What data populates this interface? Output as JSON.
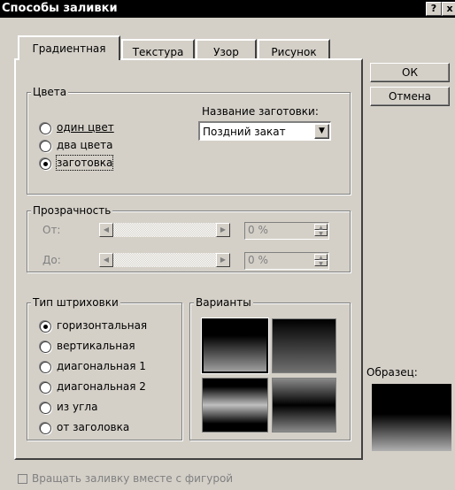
{
  "window": {
    "title": "Способы заливки",
    "help_label": "?",
    "close_label": "x"
  },
  "tabs": [
    {
      "label": "Градиентная",
      "active": true
    },
    {
      "label": "Текстура",
      "active": false
    },
    {
      "label": "Узор",
      "active": false
    },
    {
      "label": "Рисунок",
      "active": false
    }
  ],
  "buttons": {
    "ok": "ОК",
    "cancel": "Отмена"
  },
  "colors": {
    "group_label": "Цвета",
    "options": [
      {
        "label": "один цвет",
        "selected": false
      },
      {
        "label": "два цвета",
        "selected": false
      },
      {
        "label": "заготовка",
        "selected": true
      }
    ],
    "preset_label": "Название заготовки:",
    "preset_value": "Поздний закат"
  },
  "transparency": {
    "group_label": "Прозрачность",
    "from_label": "От:",
    "to_label": "До:",
    "from_value": "0 %",
    "to_value": "0 %"
  },
  "shading": {
    "group_label": "Тип штриховки",
    "options": [
      {
        "label": "горизонтальная",
        "selected": true
      },
      {
        "label": "вертикальная",
        "selected": false
      },
      {
        "label": "диагональная 1",
        "selected": false
      },
      {
        "label": "диагональная 2",
        "selected": false
      },
      {
        "label": "из угла",
        "selected": false
      },
      {
        "label": "от заголовка",
        "selected": false
      }
    ]
  },
  "variants": {
    "group_label": "Варианты"
  },
  "sample": {
    "label": "Образец:"
  },
  "rotate": {
    "label": "Вращать заливку вместе с фигурой",
    "checked": false
  }
}
